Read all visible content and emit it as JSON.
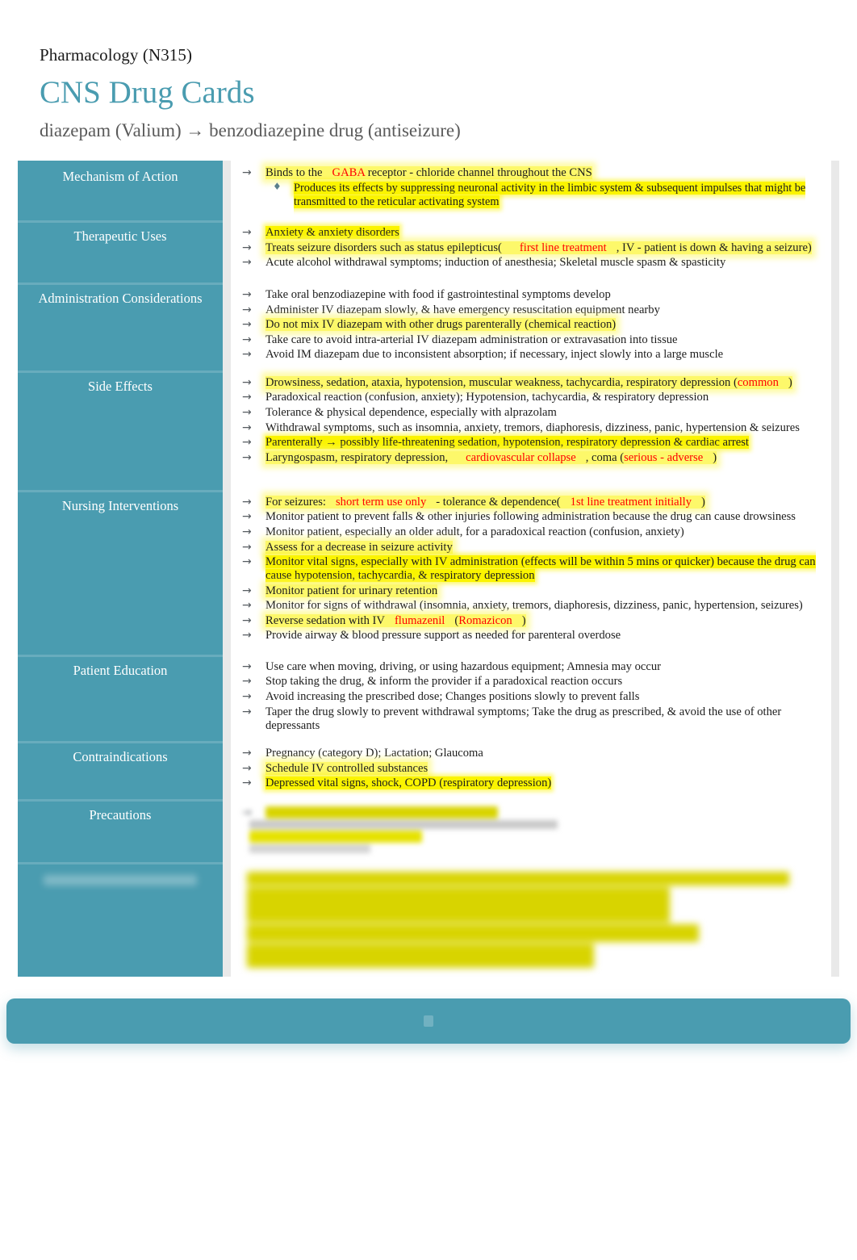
{
  "header": {
    "course": "Pharmacology (N315)",
    "title": "CNS Drug Cards",
    "subtitle": "diazepam (Valium) → benzodiazepine drug (antiseizure)"
  },
  "colors": {
    "teal": "#4a9cb0",
    "highlight_yellow": "#fbf400",
    "red_annotation": "#ff0000",
    "cell_background": "#e9e9e9",
    "page_background": "#ffffff"
  },
  "icons": {
    "bullet_arrow": "→",
    "bullet_diamond": "♦"
  },
  "sections": [
    {
      "label": "Mechanism of Action",
      "items": [
        {
          "pre": "Binds to the",
          "red": "GABA",
          "post": "receptor - chloride channel throughout the CNS",
          "sub": "Produces its effects by suppressing neuronal activity in the limbic system & subsequent impulses that might be transmitted to the reticular activating system"
        }
      ]
    },
    {
      "label": "Therapeutic Uses",
      "items": [
        {
          "text": "Anxiety & anxiety disorders"
        },
        {
          "pre": "Treats seizure disorders such as status epilepticus(",
          "red": "first line treatment",
          "post": ", IV - patient is down & having a seizure)"
        },
        {
          "text": "Acute alcohol withdrawal symptoms; induction of anesthesia; Skeletal muscle spasm & spasticity"
        }
      ]
    },
    {
      "label": "Administration Considerations",
      "items": [
        {
          "text": "Take oral benzodiazepine with food if gastrointestinal symptoms develop"
        },
        {
          "text": "Administer IV diazepam slowly, & have emergency resuscitation equipment nearby"
        },
        {
          "text": "Do not mix IV diazepam with other drugs parenterally (chemical reaction)"
        },
        {
          "text": "Take care to avoid intra-arterial IV diazepam administration or extravasation into tissue"
        },
        {
          "text": "Avoid IM diazepam due to inconsistent absorption; if necessary, inject slowly into a large muscle"
        }
      ]
    },
    {
      "label": "Side Effects",
      "items": [
        {
          "pre": "Drowsiness, sedation, ataxia, hypotension, muscular weakness, tachycardia, respiratory depression (",
          "red": "common",
          "post": ")"
        },
        {
          "text": "Paradoxical reaction (confusion, anxiety); Hypotension, tachycardia, & respiratory depression"
        },
        {
          "text": "Tolerance & physical dependence, especially with alprazolam"
        },
        {
          "text": "Withdrawal symptoms, such as insomnia, anxiety, tremors, diaphoresis, dizziness, panic, hypertension & seizures"
        },
        {
          "text": "Parenterally → possibly life-threatening sedation, hypotension, respiratory depression & cardiac arrest"
        },
        {
          "pre": "Laryngospasm, respiratory depression,",
          "red": "cardiovascular collapse",
          "mid": ", coma (",
          "red2": "serious - adverse",
          "post": ")"
        }
      ]
    },
    {
      "label": "Nursing Interventions",
      "items": [
        {
          "pre": "For seizures:",
          "red": "short term use only",
          "mid": "- tolerance & dependence(",
          "red2": "1st line treatment initially",
          "post": ")"
        },
        {
          "text": "Monitor patient to prevent falls & other injuries following administration because the drug can cause drowsiness"
        },
        {
          "text": "Monitor patient, especially an older adult, for a paradoxical reaction (confusion, anxiety)"
        },
        {
          "text": "Assess for a decrease in seizure activity"
        },
        {
          "text": "Monitor vital signs, especially with IV administration (effects will be within 5 mins or quicker) because the drug can cause hypotension, tachycardia, & respiratory depression"
        },
        {
          "text": "Monitor patient for urinary retention"
        },
        {
          "text": "Monitor for signs of withdrawal (insomnia, anxiety, tremors, diaphoresis, dizziness, panic, hypertension, seizures)"
        },
        {
          "pre": "Reverse sedation with IV",
          "red": "flumazenil",
          "mid": "(",
          "red2": "Romazicon",
          "post": ")"
        },
        {
          "text": "Provide airway & blood pressure support as needed for parenteral overdose"
        }
      ]
    },
    {
      "label": "Patient Education",
      "items": [
        {
          "text": "Use care when moving, driving, or using hazardous equipment; Amnesia may occur"
        },
        {
          "text": "Stop taking the drug, & inform the provider if a paradoxical reaction occurs"
        },
        {
          "text": "Avoid increasing the prescribed dose; Changes positions slowly to prevent falls"
        },
        {
          "text": "Taper the drug slowly to prevent withdrawal symptoms; Take the drug as prescribed, & avoid the use of other depressants"
        }
      ]
    },
    {
      "label": "Contraindications",
      "items": [
        {
          "text": "Pregnancy (category D); Lactation; Glaucoma"
        },
        {
          "text": "Schedule IV controlled substances"
        },
        {
          "text": "Depressed vital signs, shock, COPD (respiratory depression)"
        }
      ]
    },
    {
      "label": "Precautions",
      "items": []
    },
    {
      "label": "",
      "items": []
    }
  ]
}
